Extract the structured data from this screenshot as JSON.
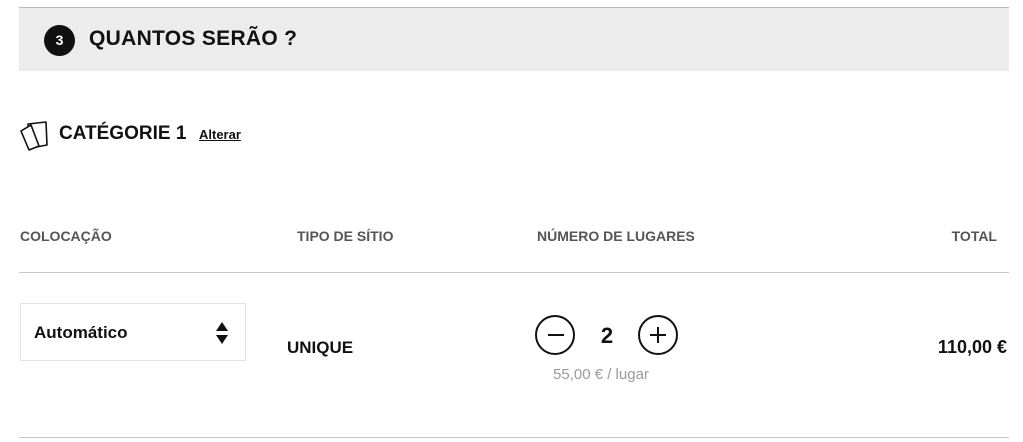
{
  "step": {
    "number": "3",
    "title": "QUANTOS SERÃO ?"
  },
  "category": {
    "icon": "ticket-icon",
    "label": "CATÉGORIE 1",
    "change_label": "Alterar"
  },
  "table": {
    "headers": {
      "placement": "COLOCAÇÃO",
      "seat_type": "TIPO DE SÍTIO",
      "seat_count": "NÚMERO DE LUGARES",
      "total": "TOTAL"
    },
    "row": {
      "placement_value": "Automático",
      "seat_type": "UNIQUE",
      "seat_count": "2",
      "unit_price": "55,00 € / lugar",
      "total": "110,00 €"
    }
  },
  "colors": {
    "header_background": "#ececec",
    "text": "#111111",
    "muted_text": "#9a9a9a",
    "column_header_text": "#555555"
  }
}
